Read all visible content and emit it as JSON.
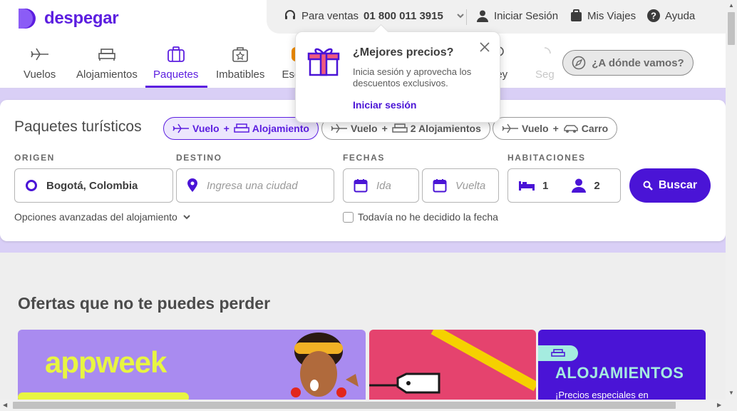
{
  "brand": {
    "name": "despegar",
    "color": "#5c1ee0"
  },
  "topbar": {
    "sales_label": "Para ventas",
    "sales_phone": "01 800 011 3915",
    "login": "Iniciar Sesión",
    "trips": "Mis Viajes",
    "help": "Ayuda"
  },
  "nav": {
    "tabs": [
      {
        "label": "Vuelos",
        "icon": "plane-icon"
      },
      {
        "label": "Alojamientos",
        "icon": "bed-icon"
      },
      {
        "label": "Paquetes",
        "icon": "suitcase-icon",
        "active": true
      },
      {
        "label": "Imbatibles",
        "icon": "star-bag-icon"
      },
      {
        "label": "Esc",
        "icon": "badge-icon"
      },
      {
        "label": "ney",
        "icon": "pin-icon"
      },
      {
        "label": "Seg",
        "icon": "shield-icon"
      }
    ],
    "where_button": "¿A dónde vamos?"
  },
  "popover": {
    "title": "¿Mejores precios?",
    "text": "Inicia sesión y aprovecha los descuentos exclusivos.",
    "link": "Iniciar sesión"
  },
  "search": {
    "title": "Paquetes turísticos",
    "modes": [
      {
        "a": "Vuelo",
        "b": "Alojamiento",
        "active": true
      },
      {
        "a": "Vuelo",
        "b": "2 Alojamientos",
        "active": false
      },
      {
        "a": "Vuelo",
        "b": "Carro",
        "active": false
      }
    ],
    "labels": {
      "origin": "ORIGEN",
      "destination": "DESTINO",
      "dates": "FECHAS",
      "rooms": "HABITACIONES"
    },
    "origin_value": "Bogotá, Colombia",
    "destination_placeholder": "Ingresa una ciudad",
    "ida_placeholder": "Ida",
    "vuelta_placeholder": "Vuelta",
    "rooms_count": "1",
    "guests_count": "2",
    "search_button": "Buscar",
    "advanced": "Opciones avanzadas del alojamiento",
    "undecided": "Todavía no he decidido la fecha"
  },
  "offers": {
    "title": "Ofertas que no te puedes perder",
    "banner1_text": "appweek",
    "banner3_title": "ALOJAMIENTOS",
    "banner3_sub": "¡Precios especiales en"
  }
}
